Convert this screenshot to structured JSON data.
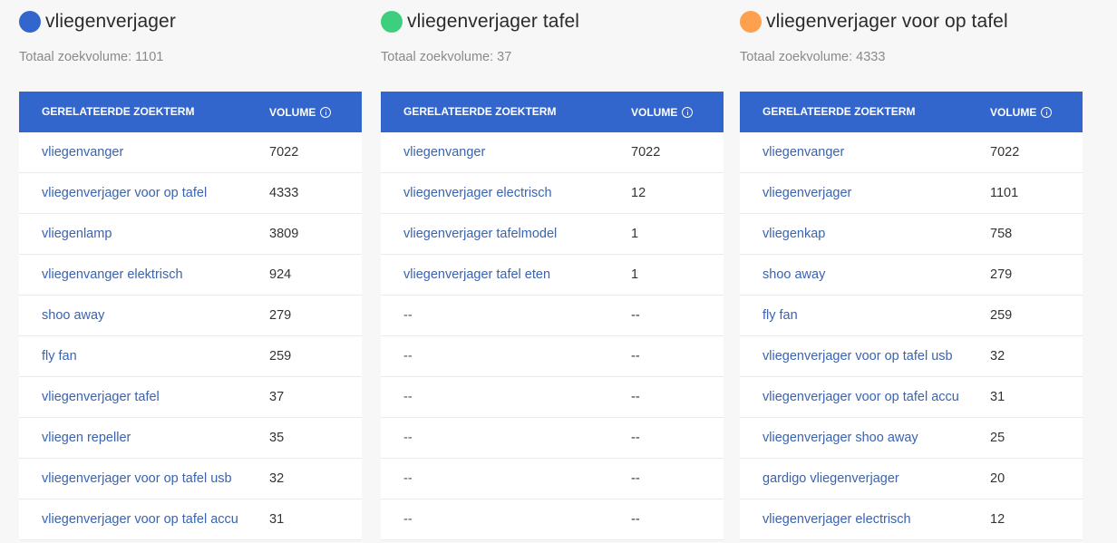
{
  "colors": {
    "header_bg": "#3366cc",
    "link": "#3a63b0",
    "dot_blue": "#3366cc",
    "dot_green": "#3ecf7e",
    "dot_orange": "#fda14f"
  },
  "table_headers": {
    "term": "GERELATEERDE ZOEKTERM",
    "volume": "VOLUME",
    "volume_icon": "info-icon"
  },
  "panels": [
    {
      "dot_color": "#3366cc",
      "title": "vliegenverjager",
      "subtitle": "Totaal zoekvolume: 1101",
      "rows": [
        {
          "term": "vliegenvanger",
          "volume": "7022"
        },
        {
          "term": "vliegenverjager voor op tafel",
          "volume": "4333"
        },
        {
          "term": "vliegenlamp",
          "volume": "3809"
        },
        {
          "term": "vliegenvanger elektrisch",
          "volume": "924"
        },
        {
          "term": "shoo away",
          "volume": "279"
        },
        {
          "term": "fly fan",
          "volume": "259"
        },
        {
          "term": "vliegenverjager tafel",
          "volume": "37"
        },
        {
          "term": "vliegen repeller",
          "volume": "35"
        },
        {
          "term": "vliegenverjager voor op tafel usb",
          "volume": "32"
        },
        {
          "term": "vliegenverjager voor op tafel accu",
          "volume": "31"
        }
      ]
    },
    {
      "dot_color": "#3ecf7e",
      "title": "vliegenverjager tafel",
      "subtitle": "Totaal zoekvolume: 37",
      "rows": [
        {
          "term": "vliegenvanger",
          "volume": "7022"
        },
        {
          "term": "vliegenverjager electrisch",
          "volume": "12"
        },
        {
          "term": "vliegenverjager tafelmodel",
          "volume": "1"
        },
        {
          "term": "vliegenverjager tafel eten",
          "volume": "1"
        },
        {
          "term": "--",
          "volume": "--"
        },
        {
          "term": "--",
          "volume": "--"
        },
        {
          "term": "--",
          "volume": "--"
        },
        {
          "term": "--",
          "volume": "--"
        },
        {
          "term": "--",
          "volume": "--"
        },
        {
          "term": "--",
          "volume": "--"
        }
      ]
    },
    {
      "dot_color": "#fda14f",
      "title": "vliegenverjager voor op tafel",
      "subtitle": "Totaal zoekvolume: 4333",
      "rows": [
        {
          "term": "vliegenvanger",
          "volume": "7022"
        },
        {
          "term": "vliegenverjager",
          "volume": "1101"
        },
        {
          "term": "vliegenkap",
          "volume": "758"
        },
        {
          "term": "shoo away",
          "volume": "279"
        },
        {
          "term": "fly fan",
          "volume": "259"
        },
        {
          "term": "vliegenverjager voor op tafel usb",
          "volume": "32"
        },
        {
          "term": "vliegenverjager voor op tafel accu",
          "volume": "31"
        },
        {
          "term": "vliegenverjager shoo away",
          "volume": "25"
        },
        {
          "term": "gardigo vliegenverjager",
          "volume": "20"
        },
        {
          "term": "vliegenverjager electrisch",
          "volume": "12"
        }
      ]
    }
  ]
}
